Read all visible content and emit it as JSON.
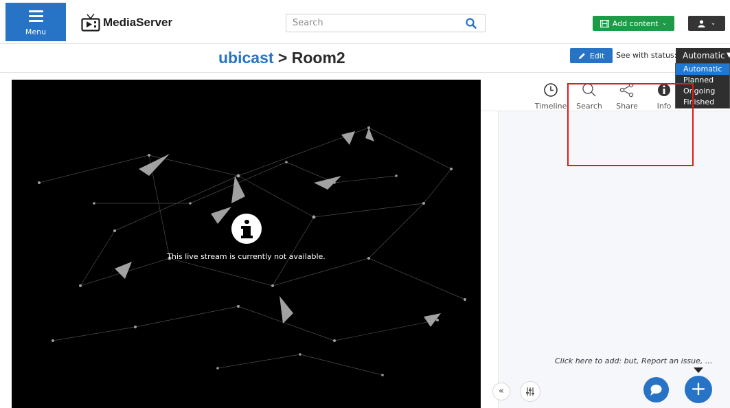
{
  "header": {
    "menu_label": "Menu",
    "logo_text": "MediaServer",
    "search_placeholder": "Search",
    "add_content_label": "Add content",
    "accent": "#2773c6",
    "add_color": "#1e9b47"
  },
  "breadcrumb": {
    "channel": "ubicast",
    "separator": ">",
    "room": "Room2"
  },
  "toolbar": {
    "edit_label": "Edit",
    "status_label": "See with status:",
    "status_value": "Automatic",
    "status_options": [
      "Automatic",
      "Planned",
      "Ongoing",
      "Finished"
    ]
  },
  "player": {
    "message": "This live stream is currently not available."
  },
  "side_panel": {
    "tabs": [
      {
        "label": "Timeline",
        "icon": "clock-icon"
      },
      {
        "label": "Search",
        "icon": "search-icon"
      },
      {
        "label": "Share",
        "icon": "share-icon"
      },
      {
        "label": "Info",
        "icon": "info-icon"
      }
    ],
    "active_tab": "Timeline",
    "hint": "Click here to add: but, Report an issue, ..."
  }
}
